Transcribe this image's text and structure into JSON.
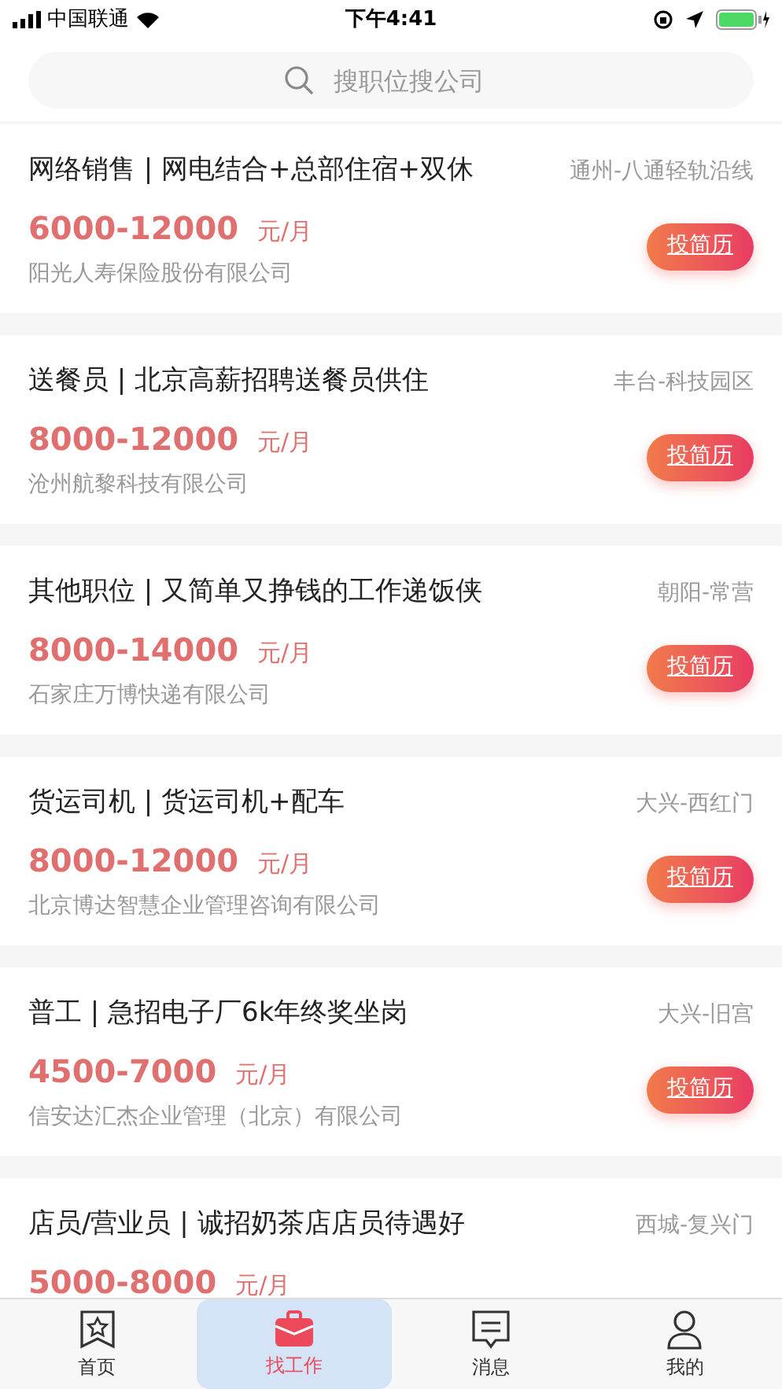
{
  "status_bar": {
    "carrier": "中国联通",
    "time": "下午4:41"
  },
  "search": {
    "placeholder": "搜职位搜公司"
  },
  "jobs": [
    {
      "title": "网络销售 | 网电结合+总部住宿+双休",
      "location": "通州-八通轻轨沿线",
      "salary": "6000-12000",
      "unit": "元/月",
      "company": "阳光人寿保险股份有限公司",
      "action": "投简历"
    },
    {
      "title": "送餐员 | 北京高薪招聘送餐员供住",
      "location": "丰台-科技园区",
      "salary": "8000-12000",
      "unit": "元/月",
      "company": "沧州航黎科技有限公司",
      "action": "投简历"
    },
    {
      "title": "其他职位 | 又简单又挣钱的工作递饭侠",
      "location": "朝阳-常营",
      "salary": "8000-14000",
      "unit": "元/月",
      "company": "石家庄万博快递有限公司",
      "action": "投简历"
    },
    {
      "title": "货运司机 | 货运司机+配车",
      "location": "大兴-西红门",
      "salary": "8000-12000",
      "unit": "元/月",
      "company": "北京博达智慧企业管理咨询有限公司",
      "action": "投简历"
    },
    {
      "title": "普工 | 急招电子厂6k年终奖坐岗",
      "location": "大兴-旧宫",
      "salary": "4500-7000",
      "unit": "元/月",
      "company": "信安达汇杰企业管理（北京）有限公司",
      "action": "投简历"
    },
    {
      "title": "店员/营业员 | 诚招奶茶店店员待遇好",
      "location": "西城-复兴门",
      "salary": "5000-8000",
      "unit": "元/月"
    }
  ],
  "tabs": [
    {
      "label": "首页",
      "kind": "home",
      "selected": false
    },
    {
      "label": "找工作",
      "kind": "jobs",
      "selected": true
    },
    {
      "label": "消息",
      "kind": "messages",
      "selected": false
    },
    {
      "label": "我的",
      "kind": "profile",
      "selected": false
    }
  ]
}
